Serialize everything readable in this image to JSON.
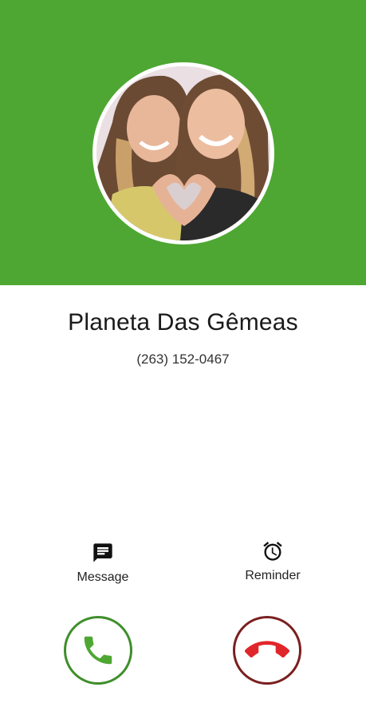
{
  "caller": {
    "name": "Planeta Das Gêmeas",
    "number": "(263) 152-0467"
  },
  "actions": {
    "message_label": "Message",
    "reminder_label": "Reminder"
  },
  "icons": {
    "message": "message-icon",
    "reminder": "alarm-clock-icon",
    "accept": "phone-icon",
    "decline": "hang-up-icon"
  },
  "colors": {
    "header": "#4ea732",
    "accept": "#4ea732",
    "decline": "#e0262b"
  }
}
